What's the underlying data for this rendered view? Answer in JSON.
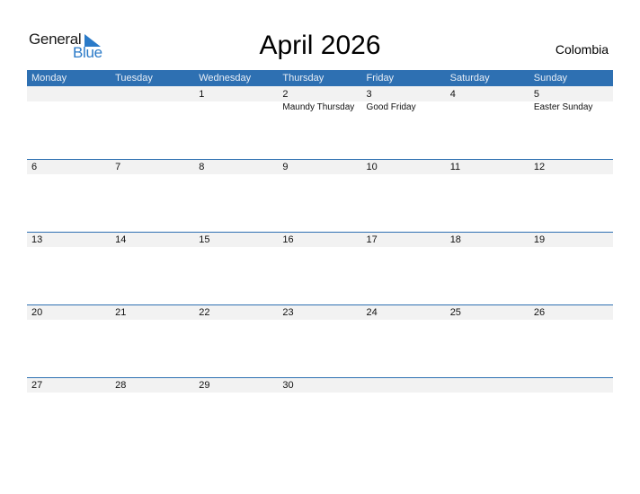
{
  "logo": {
    "general": "General",
    "blue": "Blue"
  },
  "title": "April 2026",
  "country": "Colombia",
  "accent_color": "#2e70b2",
  "weekdays": [
    "Monday",
    "Tuesday",
    "Wednesday",
    "Thursday",
    "Friday",
    "Saturday",
    "Sunday"
  ],
  "weeks": [
    [
      {
        "day": ""
      },
      {
        "day": ""
      },
      {
        "day": "1"
      },
      {
        "day": "2",
        "holiday": "Maundy Thursday"
      },
      {
        "day": "3",
        "holiday": "Good Friday"
      },
      {
        "day": "4"
      },
      {
        "day": "5",
        "holiday": "Easter Sunday"
      }
    ],
    [
      {
        "day": "6"
      },
      {
        "day": "7"
      },
      {
        "day": "8"
      },
      {
        "day": "9"
      },
      {
        "day": "10"
      },
      {
        "day": "11"
      },
      {
        "day": "12"
      }
    ],
    [
      {
        "day": "13"
      },
      {
        "day": "14"
      },
      {
        "day": "15"
      },
      {
        "day": "16"
      },
      {
        "day": "17"
      },
      {
        "day": "18"
      },
      {
        "day": "19"
      }
    ],
    [
      {
        "day": "20"
      },
      {
        "day": "21"
      },
      {
        "day": "22"
      },
      {
        "day": "23"
      },
      {
        "day": "24"
      },
      {
        "day": "25"
      },
      {
        "day": "26"
      }
    ],
    [
      {
        "day": "27"
      },
      {
        "day": "28"
      },
      {
        "day": "29"
      },
      {
        "day": "30"
      },
      {
        "day": ""
      },
      {
        "day": ""
      },
      {
        "day": ""
      }
    ]
  ]
}
